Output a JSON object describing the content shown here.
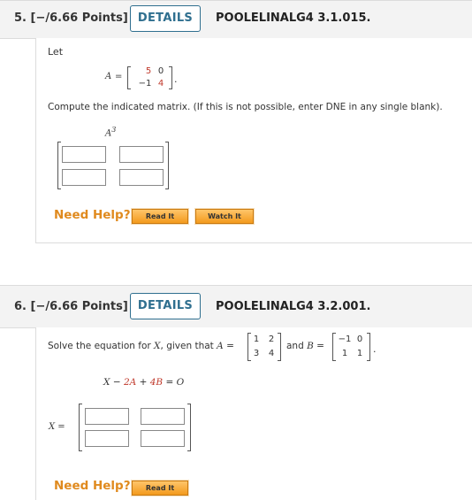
{
  "q5": {
    "number": "5. [−/6.66 Points]",
    "details_label": "DETAILS",
    "reference": "POOLELINALG4 3.1.015.",
    "let_label": "Let",
    "matrix_var": "A",
    "eq": "=",
    "matrix": [
      [
        "5",
        "0"
      ],
      [
        "−1",
        "4"
      ]
    ],
    "period": ".",
    "instruction": "Compute the indicated matrix. (If this is not possible, enter DNE in any single blank).",
    "expr_base": "A",
    "expr_exp": "3",
    "help_label": "Need Help?",
    "read_label": "Read It",
    "watch_label": "Watch It"
  },
  "q6": {
    "number": "6. [−/6.66 Points]",
    "details_label": "DETAILS",
    "reference": "POOLELINALG4 3.2.001.",
    "prompt": "Solve the equation for",
    "x_var": "X",
    "prompt_mid": ", given that",
    "a_var": "A",
    "eq": "=",
    "a_matrix": [
      [
        "1",
        "2"
      ],
      [
        "3",
        "4"
      ]
    ],
    "and_label": "and",
    "b_var": "B",
    "b_matrix": [
      [
        "−1",
        "0"
      ],
      [
        "1",
        "1"
      ]
    ],
    "period": ".",
    "equation": {
      "x": "X",
      "minus": "−",
      "two_a": "2A",
      "plus": "+",
      "four_b": "4B",
      "equals": "=",
      "zero": "O"
    },
    "answer_label": "X =",
    "help_label": "Need Help?",
    "read_label": "Read It"
  }
}
